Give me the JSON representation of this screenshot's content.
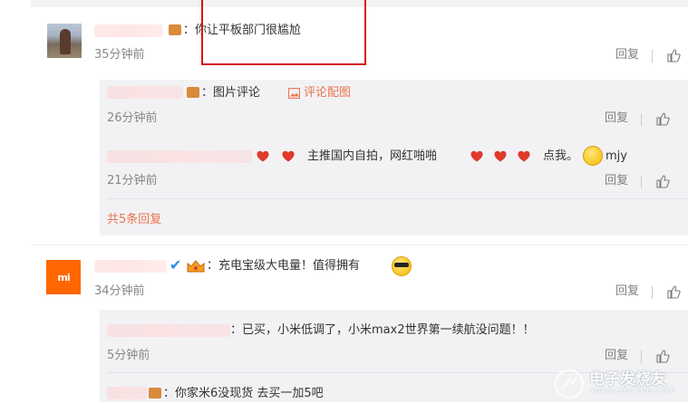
{
  "comments": [
    {
      "text": "：你让平板部门很尴尬",
      "time": "35分钟前",
      "reply_label": "回复",
      "replies": [
        {
          "text": "：图片评论",
          "extra_link": "评论配图",
          "time": "26分钟前",
          "reply_label": "回复"
        },
        {
          "text_before": "主推国内自拍，网红啪啪",
          "text_after": "点我。",
          "trailing_text": "mjy",
          "time": "21分钟前",
          "reply_label": "回复"
        }
      ],
      "more_replies": "共5条回复"
    },
    {
      "text": "：充电宝级大电量！值得拥有",
      "time": "34分钟前",
      "reply_label": "回复",
      "avatar_label": "mi",
      "replies": [
        {
          "text": "：已买，小米低调了，小米max2世界第一续航没问题！！",
          "time": "5分钟前",
          "reply_label": "回复"
        },
        {
          "text": "：你家米6没现货 去买一加5吧"
        }
      ]
    }
  ],
  "watermark": {
    "title": "电子发烧友",
    "url": "www.elecfans.com"
  },
  "icons": {
    "like": "thumbs-up-icon",
    "image": "image-icon",
    "heart": "heart-icon",
    "smile": "smile-emoji-icon",
    "cool": "sunglasses-emoji-icon",
    "verified": "verified-check-icon"
  },
  "colors": {
    "accent": "#eb7350",
    "highlight": "#d9121b",
    "mi_brand": "#ff6700",
    "reply_bg": "#f2f2f5"
  }
}
